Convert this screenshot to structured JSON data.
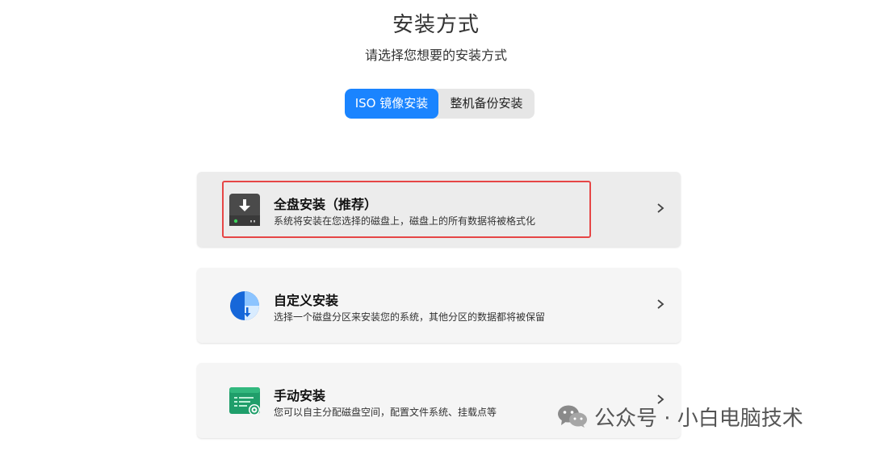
{
  "header": {
    "title": "安装方式",
    "subtitle": "请选择您想要的安装方式"
  },
  "tabs": {
    "iso_label": "ISO 镜像安装",
    "backup_label": "整机备份安装",
    "active": "iso"
  },
  "options": [
    {
      "title": "全盘安装（推荐）",
      "description": "系统将安装在您选择的磁盘上，磁盘上的所有数据将被格式化",
      "icon": "disk-download-icon",
      "selected": true
    },
    {
      "title": "自定义安装",
      "description": "选择一个磁盘分区来安装您的系统，其他分区的数据都将被保留",
      "icon": "partition-pie-icon",
      "selected": false
    },
    {
      "title": "手动安装",
      "description": "您可以自主分配磁盘空间，配置文件系统、挂载点等",
      "icon": "manual-config-icon",
      "selected": false
    }
  ],
  "watermark": {
    "text": "公众号 · 小白电脑技术",
    "icon": "wechat-icon"
  },
  "colors": {
    "accent": "#1a84ff",
    "highlight": "#e64646"
  }
}
